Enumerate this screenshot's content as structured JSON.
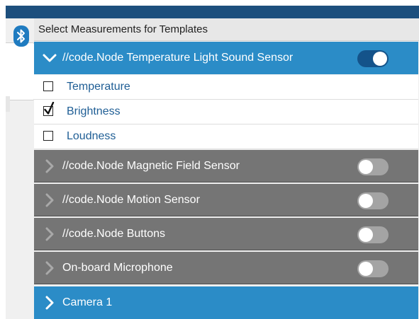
{
  "panel": {
    "title": "Select Measurements for Templates"
  },
  "sensors": [
    {
      "name": "//code.Node Temperature Light Sound Sensor",
      "expanded": true,
      "enabled": true,
      "measurements": [
        {
          "label": "Temperature",
          "checked": false
        },
        {
          "label": "Brightness",
          "checked": true
        },
        {
          "label": "Loudness",
          "checked": false
        }
      ]
    },
    {
      "name": "//code.Node Magnetic Field Sensor",
      "expanded": false,
      "enabled": false
    },
    {
      "name": "//code.Node Motion Sensor",
      "expanded": false,
      "enabled": false
    },
    {
      "name": "//code.Node Buttons",
      "expanded": false,
      "enabled": false
    },
    {
      "name": "On-board Microphone",
      "expanded": false,
      "enabled": false
    },
    {
      "name": "Camera 1",
      "expanded": false
    }
  ],
  "icons": {
    "sidebar": "bluetooth-icon",
    "expand": "chevron-down-icon",
    "collapse": "chevron-right-icon"
  },
  "colors": {
    "top_bar": "#1d4f7d",
    "row_active": "#2b8cc7",
    "row_inactive": "#757575",
    "toggle_on": "#14538a",
    "toggle_off": "#a4a4a4",
    "label": "#1f5e95"
  }
}
